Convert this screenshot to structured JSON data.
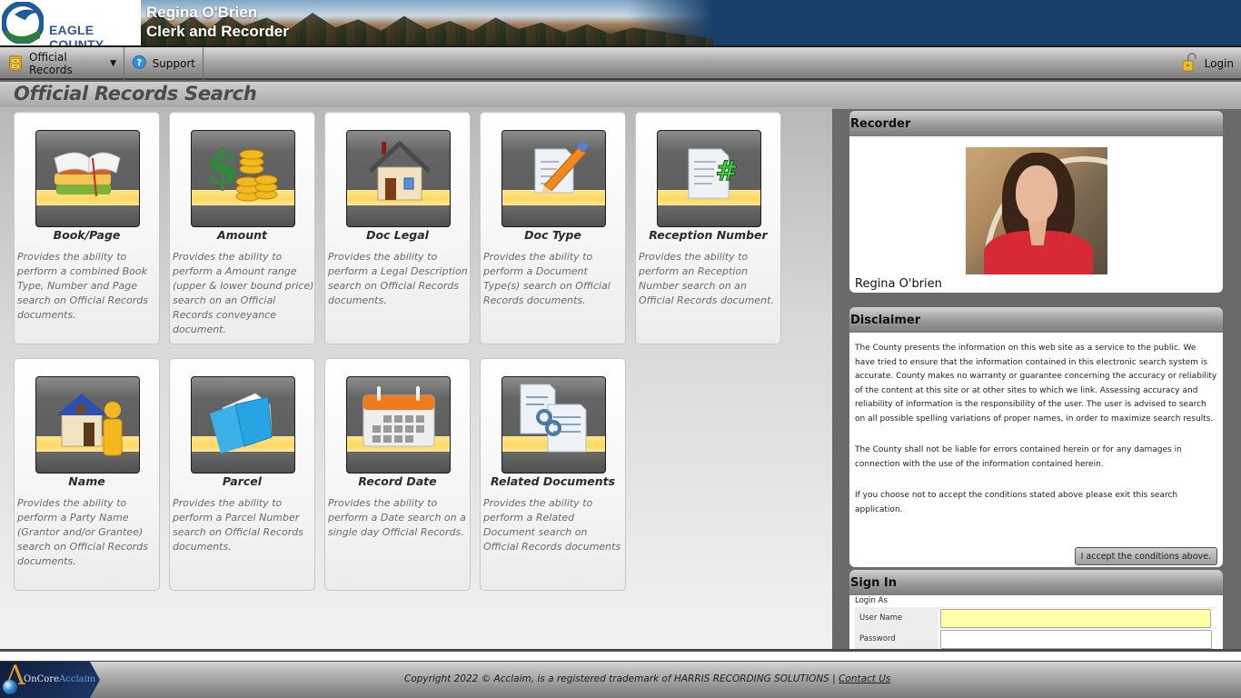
{
  "header": {
    "logo_text": "EAGLE COUNTY",
    "title_line1": "Regina O'Brien",
    "title_line2": "Clerk and Recorder",
    "brand_color": "#163f6a"
  },
  "nav": {
    "official_records": "Official Records",
    "support": "Support",
    "login": "Login"
  },
  "page": {
    "title": "Official Records Search"
  },
  "tiles": [
    {
      "title": "Book/Page",
      "description": "Provides the ability to perform a combined Book Type, Number and Page search on Official Records documents.",
      "icon": "books-icon"
    },
    {
      "title": "Amount",
      "description": "Provides the ability to perform a Amount range (upper & lower bound price) search on an Official Records conveyance document.",
      "icon": "dollar-coins-icon"
    },
    {
      "title": "Doc Legal",
      "description": "Provides the ability to perform a Legal Description search on Official Records documents.",
      "icon": "house-icon"
    },
    {
      "title": "Doc Type",
      "description": "Provides the ability to perform a Document Type(s) search on Official Records documents.",
      "icon": "document-pencil-icon"
    },
    {
      "title": "Reception Number",
      "description": "Provides the ability to perform an Reception Number search on an Official Records document.",
      "icon": "document-hash-icon"
    },
    {
      "title": "Name",
      "description": "Provides the ability to perform a Party Name (Grantor and/or Grantee) search on Official Records documents.",
      "icon": "house-person-icon"
    },
    {
      "title": "Parcel",
      "description": "Provides the ability to perform a Parcel Number search on Official Records documents.",
      "icon": "folder-icon"
    },
    {
      "title": "Record Date",
      "description": "Provides the ability to perform a Date search on a single day Official Records.",
      "icon": "calendar-icon"
    },
    {
      "title": "Related Documents",
      "description": "Provides the ability to perform a Related Document search on Official Records documents",
      "icon": "linked-documents-icon"
    }
  ],
  "recorder": {
    "heading": "Recorder",
    "name": "Regina O'brien"
  },
  "disclaimer": {
    "heading": "Disclaimer",
    "paragraphs": [
      "The County presents the information on this web site as a service to the public. We have tried to ensure that the information contained in this electronic search system is accurate. County makes no warranty or guarantee concerning the accuracy or reliability of the content at this site or at other sites to which we link. Assessing accuracy and reliability of information is the responsibility of the user. The user is advised to search on all possible spelling variations of proper names, in order to maximize search results.",
      "The County shall not be liable for errors contained herein or for any damages in connection with the use of the information contained herein.",
      "If you choose not to accept the conditions stated above please exit this search application."
    ],
    "accept_label": "I accept the conditions above."
  },
  "signin": {
    "heading": "Sign In",
    "login_as": "Login As",
    "username_label": "User Name",
    "username_value": "",
    "password_label": "Password",
    "password_value": ""
  },
  "footer": {
    "brand_part1": "OnCore",
    "brand_part2": "Acclaim",
    "copyright": "Copyright 2022 © Acclaim, is a registered trademark of HARRIS RECORDING SOLUTIONS | ",
    "contact_label": "Contact Us"
  }
}
